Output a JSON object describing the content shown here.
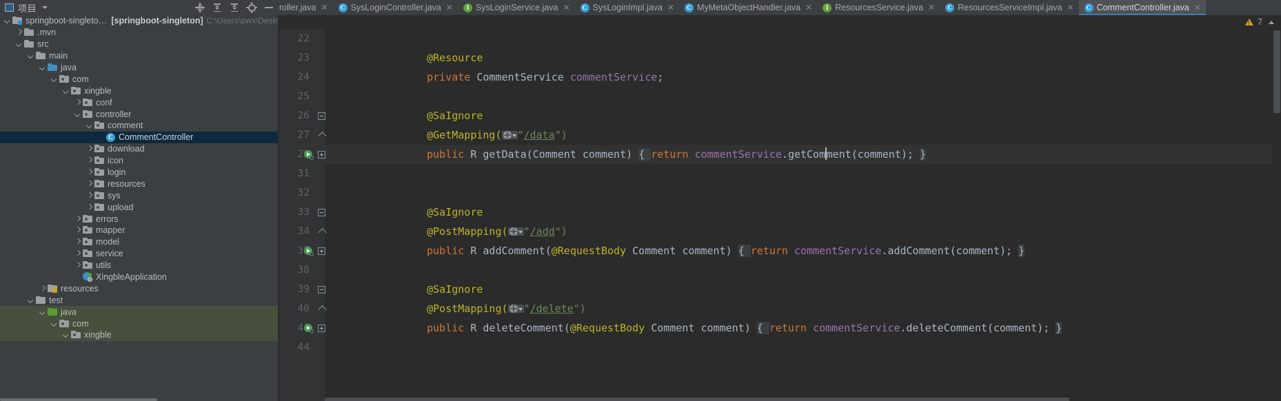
{
  "project_panel": {
    "title": "项目",
    "icons": [
      "project-icon",
      "chevron-down-icon",
      "locate-icon",
      "expand-all-icon",
      "collapse-all-icon",
      "gear-icon",
      "hide-icon"
    ],
    "tree": [
      {
        "indent": 0,
        "arrow": "down",
        "icon": "module-icon",
        "label": "springboot-singleton-master",
        "bold_label": "[springboot-singleton]",
        "path": "C:\\Users\\pwx\\Deskt"
      },
      {
        "indent": 1,
        "arrow": "right",
        "icon": "folder-icon",
        "label": ".mvn"
      },
      {
        "indent": 1,
        "arrow": "down",
        "icon": "folder-icon",
        "label": "src"
      },
      {
        "indent": 2,
        "arrow": "down",
        "icon": "folder-icon",
        "label": "main"
      },
      {
        "indent": 3,
        "arrow": "down",
        "icon": "folder-blue-icon",
        "label": "java"
      },
      {
        "indent": 4,
        "arrow": "down",
        "icon": "package-icon",
        "label": "com"
      },
      {
        "indent": 5,
        "arrow": "down",
        "icon": "package-icon",
        "label": "xingble"
      },
      {
        "indent": 6,
        "arrow": "right",
        "icon": "package-icon",
        "label": "conf"
      },
      {
        "indent": 6,
        "arrow": "down",
        "icon": "package-icon",
        "label": "controller"
      },
      {
        "indent": 7,
        "arrow": "down",
        "icon": "package-icon",
        "label": "comment"
      },
      {
        "indent": 8,
        "arrow": "none",
        "icon": "java-class-icon",
        "label": "CommentController",
        "selected": true
      },
      {
        "indent": 7,
        "arrow": "right",
        "icon": "package-icon",
        "label": "download"
      },
      {
        "indent": 7,
        "arrow": "right",
        "icon": "package-icon",
        "label": "icon"
      },
      {
        "indent": 7,
        "arrow": "right",
        "icon": "package-icon",
        "label": "login"
      },
      {
        "indent": 7,
        "arrow": "right",
        "icon": "package-icon",
        "label": "resources"
      },
      {
        "indent": 7,
        "arrow": "right",
        "icon": "package-icon",
        "label": "sys"
      },
      {
        "indent": 7,
        "arrow": "right",
        "icon": "package-icon",
        "label": "upload"
      },
      {
        "indent": 6,
        "arrow": "right",
        "icon": "package-icon",
        "label": "errors"
      },
      {
        "indent": 6,
        "arrow": "right",
        "icon": "package-icon",
        "label": "mapper"
      },
      {
        "indent": 6,
        "arrow": "right",
        "icon": "package-icon",
        "label": "model"
      },
      {
        "indent": 6,
        "arrow": "right",
        "icon": "package-icon",
        "label": "service"
      },
      {
        "indent": 6,
        "arrow": "right",
        "icon": "package-icon",
        "label": "utils"
      },
      {
        "indent": 6,
        "arrow": "none",
        "icon": "spring-boot-icon",
        "label": "XingbleApplication"
      },
      {
        "indent": 3,
        "arrow": "right",
        "icon": "resources-folder-icon",
        "label": "resources"
      },
      {
        "indent": 2,
        "arrow": "down",
        "icon": "folder-icon",
        "label": "test"
      },
      {
        "indent": 3,
        "arrow": "down",
        "icon": "folder-green-icon",
        "label": "java",
        "testband": true
      },
      {
        "indent": 4,
        "arrow": "down",
        "icon": "package-icon",
        "label": "com",
        "testband": true
      },
      {
        "indent": 5,
        "arrow": "down",
        "icon": "package-icon",
        "label": "xingble",
        "testband": true
      }
    ]
  },
  "tabs": [
    {
      "label": "roller.java",
      "icon": "none",
      "clipped": true,
      "active": false
    },
    {
      "label": "SysLoginController.java",
      "icon": "class",
      "active": false
    },
    {
      "label": "SysLoginService.java",
      "icon": "interface",
      "active": false
    },
    {
      "label": "SysLoginImpl.java",
      "icon": "class",
      "active": false
    },
    {
      "label": "MyMetaObjectHandler.java",
      "icon": "class",
      "active": false
    },
    {
      "label": "ResourcesService.java",
      "icon": "interface",
      "active": false
    },
    {
      "label": "ResourcesServiceImpl.java",
      "icon": "class",
      "active": false
    },
    {
      "label": "CommentController.java",
      "icon": "class",
      "active": true
    }
  ],
  "tab_close_glyph": "✕",
  "class_icon_letter": "C",
  "interface_icon_letter": "I",
  "status": {
    "warning_count": "7",
    "warning_icon": "warning-triangle-icon",
    "collapse_chevron": "chevron-up-icon"
  },
  "editor": {
    "lines": [
      {
        "num": "22",
        "segments": []
      },
      {
        "num": "23",
        "segments": [
          {
            "t": "    ",
            "c": "s-punc"
          },
          {
            "t": "@Resource",
            "c": "s-anno"
          }
        ]
      },
      {
        "num": "24",
        "segments": [
          {
            "t": "    ",
            "c": "s-punc"
          },
          {
            "t": "private",
            "c": "s-kw"
          },
          {
            "t": " ",
            "c": "s-punc"
          },
          {
            "t": "CommentService",
            "c": "s-type"
          },
          {
            "t": " ",
            "c": "s-punc"
          },
          {
            "t": "commentService",
            "c": "s-field"
          },
          {
            "t": ";",
            "c": "s-punc"
          }
        ]
      },
      {
        "num": "25",
        "segments": []
      },
      {
        "num": "26",
        "segments": [
          {
            "t": "    ",
            "c": "s-punc"
          },
          {
            "t": "@SaIgnore",
            "c": "s-anno"
          }
        ],
        "fold": "top"
      },
      {
        "num": "27",
        "segments": [
          {
            "t": "    ",
            "c": "s-punc"
          },
          {
            "t": "@GetMapping(",
            "c": "s-anno"
          },
          {
            "t": "WEBICON",
            "c": "icon"
          },
          {
            "t": "\"",
            "c": "s-str"
          },
          {
            "t": "/data",
            "c": "strlink"
          },
          {
            "t": "\")",
            "c": "s-str"
          }
        ],
        "fold": "tip"
      },
      {
        "num": "28",
        "segments": [
          {
            "t": "    ",
            "c": "s-punc"
          },
          {
            "t": "public",
            "c": "s-kw"
          },
          {
            "t": " ",
            "c": "s-punc"
          },
          {
            "t": "R",
            "c": "s-type"
          },
          {
            "t": " ",
            "c": "s-punc"
          },
          {
            "t": "getData",
            "c": "s-meth"
          },
          {
            "t": "(",
            "c": "s-punc"
          },
          {
            "t": "Comment",
            "c": "s-type"
          },
          {
            "t": " ",
            "c": "s-punc"
          },
          {
            "t": "comment",
            "c": "s-param"
          },
          {
            "t": ") ",
            "c": "s-punc"
          },
          {
            "t": "{ ",
            "c": "foldbg"
          },
          {
            "t": "return",
            "c": "s-kw"
          },
          {
            "t": " ",
            "c": "s-punc"
          },
          {
            "t": "commentService",
            "c": "s-field"
          },
          {
            "t": ".",
            "c": "s-punc"
          },
          {
            "t": "getCom",
            "c": "s-meth"
          },
          {
            "t": "CARET",
            "c": "caret"
          },
          {
            "t": "ment",
            "c": "s-meth"
          },
          {
            "t": "(",
            "c": "s-punc"
          },
          {
            "t": "comment",
            "c": "s-param"
          },
          {
            "t": "); ",
            "c": "s-punc"
          },
          {
            "t": "}",
            "c": "foldbg"
          }
        ],
        "highlight": true,
        "gutter": "run",
        "fold": "plus"
      },
      {
        "num": "31",
        "segments": []
      },
      {
        "num": "32",
        "segments": []
      },
      {
        "num": "33",
        "segments": [
          {
            "t": "    ",
            "c": "s-punc"
          },
          {
            "t": "@SaIgnore",
            "c": "s-anno"
          }
        ],
        "fold": "top"
      },
      {
        "num": "34",
        "segments": [
          {
            "t": "    ",
            "c": "s-punc"
          },
          {
            "t": "@PostMapping(",
            "c": "s-anno"
          },
          {
            "t": "WEBICON",
            "c": "icon"
          },
          {
            "t": "\"",
            "c": "s-str"
          },
          {
            "t": "/add",
            "c": "strlink"
          },
          {
            "t": "\")",
            "c": "s-str"
          }
        ],
        "fold": "tip"
      },
      {
        "num": "35",
        "segments": [
          {
            "t": "    ",
            "c": "s-punc"
          },
          {
            "t": "public",
            "c": "s-kw"
          },
          {
            "t": " ",
            "c": "s-punc"
          },
          {
            "t": "R",
            "c": "s-type"
          },
          {
            "t": " ",
            "c": "s-punc"
          },
          {
            "t": "addComment",
            "c": "s-meth"
          },
          {
            "t": "(",
            "c": "s-punc"
          },
          {
            "t": "@RequestBody",
            "c": "s-anno"
          },
          {
            "t": " ",
            "c": "s-punc"
          },
          {
            "t": "Comment",
            "c": "s-type"
          },
          {
            "t": " ",
            "c": "s-punc"
          },
          {
            "t": "comment",
            "c": "s-param"
          },
          {
            "t": ") ",
            "c": "s-punc"
          },
          {
            "t": "{ ",
            "c": "foldbg"
          },
          {
            "t": "return",
            "c": "s-kw"
          },
          {
            "t": " ",
            "c": "s-punc"
          },
          {
            "t": "commentService",
            "c": "s-field"
          },
          {
            "t": ".",
            "c": "s-punc"
          },
          {
            "t": "addComment",
            "c": "s-meth"
          },
          {
            "t": "(",
            "c": "s-punc"
          },
          {
            "t": "comment",
            "c": "s-param"
          },
          {
            "t": "); ",
            "c": "s-punc"
          },
          {
            "t": "}",
            "c": "foldbg"
          }
        ],
        "gutter": "run",
        "fold": "plus"
      },
      {
        "num": "38",
        "segments": []
      },
      {
        "num": "39",
        "segments": [
          {
            "t": "    ",
            "c": "s-punc"
          },
          {
            "t": "@SaIgnore",
            "c": "s-anno"
          }
        ],
        "fold": "top"
      },
      {
        "num": "40",
        "segments": [
          {
            "t": "    ",
            "c": "s-punc"
          },
          {
            "t": "@PostMapping(",
            "c": "s-anno"
          },
          {
            "t": "WEBICON",
            "c": "icon"
          },
          {
            "t": "\"",
            "c": "s-str"
          },
          {
            "t": "/delete",
            "c": "strlink"
          },
          {
            "t": "\")",
            "c": "s-str"
          }
        ],
        "fold": "tip"
      },
      {
        "num": "41",
        "segments": [
          {
            "t": "    ",
            "c": "s-punc"
          },
          {
            "t": "public",
            "c": "s-kw"
          },
          {
            "t": " ",
            "c": "s-punc"
          },
          {
            "t": "R",
            "c": "s-type"
          },
          {
            "t": " ",
            "c": "s-punc"
          },
          {
            "t": "deleteComment",
            "c": "s-meth"
          },
          {
            "t": "(",
            "c": "s-punc"
          },
          {
            "t": "@RequestBody",
            "c": "s-anno"
          },
          {
            "t": " ",
            "c": "s-punc"
          },
          {
            "t": "Comment",
            "c": "s-type"
          },
          {
            "t": " ",
            "c": "s-punc"
          },
          {
            "t": "comment",
            "c": "s-param"
          },
          {
            "t": ") ",
            "c": "s-punc"
          },
          {
            "t": "{ ",
            "c": "foldbg"
          },
          {
            "t": "return",
            "c": "s-kw"
          },
          {
            "t": " ",
            "c": "s-punc"
          },
          {
            "t": "commentService",
            "c": "s-field"
          },
          {
            "t": ".",
            "c": "s-punc"
          },
          {
            "t": "deleteComment",
            "c": "s-meth"
          },
          {
            "t": "(",
            "c": "s-punc"
          },
          {
            "t": "comment",
            "c": "s-param"
          },
          {
            "t": "); ",
            "c": "s-punc"
          },
          {
            "t": "}",
            "c": "foldbg"
          }
        ],
        "gutter": "run",
        "fold": "plus"
      },
      {
        "num": "44",
        "segments": []
      }
    ]
  },
  "colors": {
    "bg_editor": "#2b2b2b",
    "bg_panel": "#3c3f41",
    "gutter": "#313335",
    "accent_tab": "#3d7cc9",
    "selection": "#0d293e",
    "test_band": "#46503c",
    "annotation": "#bbb529",
    "keyword": "#cc7832",
    "field": "#9876aa",
    "string": "#6a8759",
    "warning": "#d6a020"
  }
}
